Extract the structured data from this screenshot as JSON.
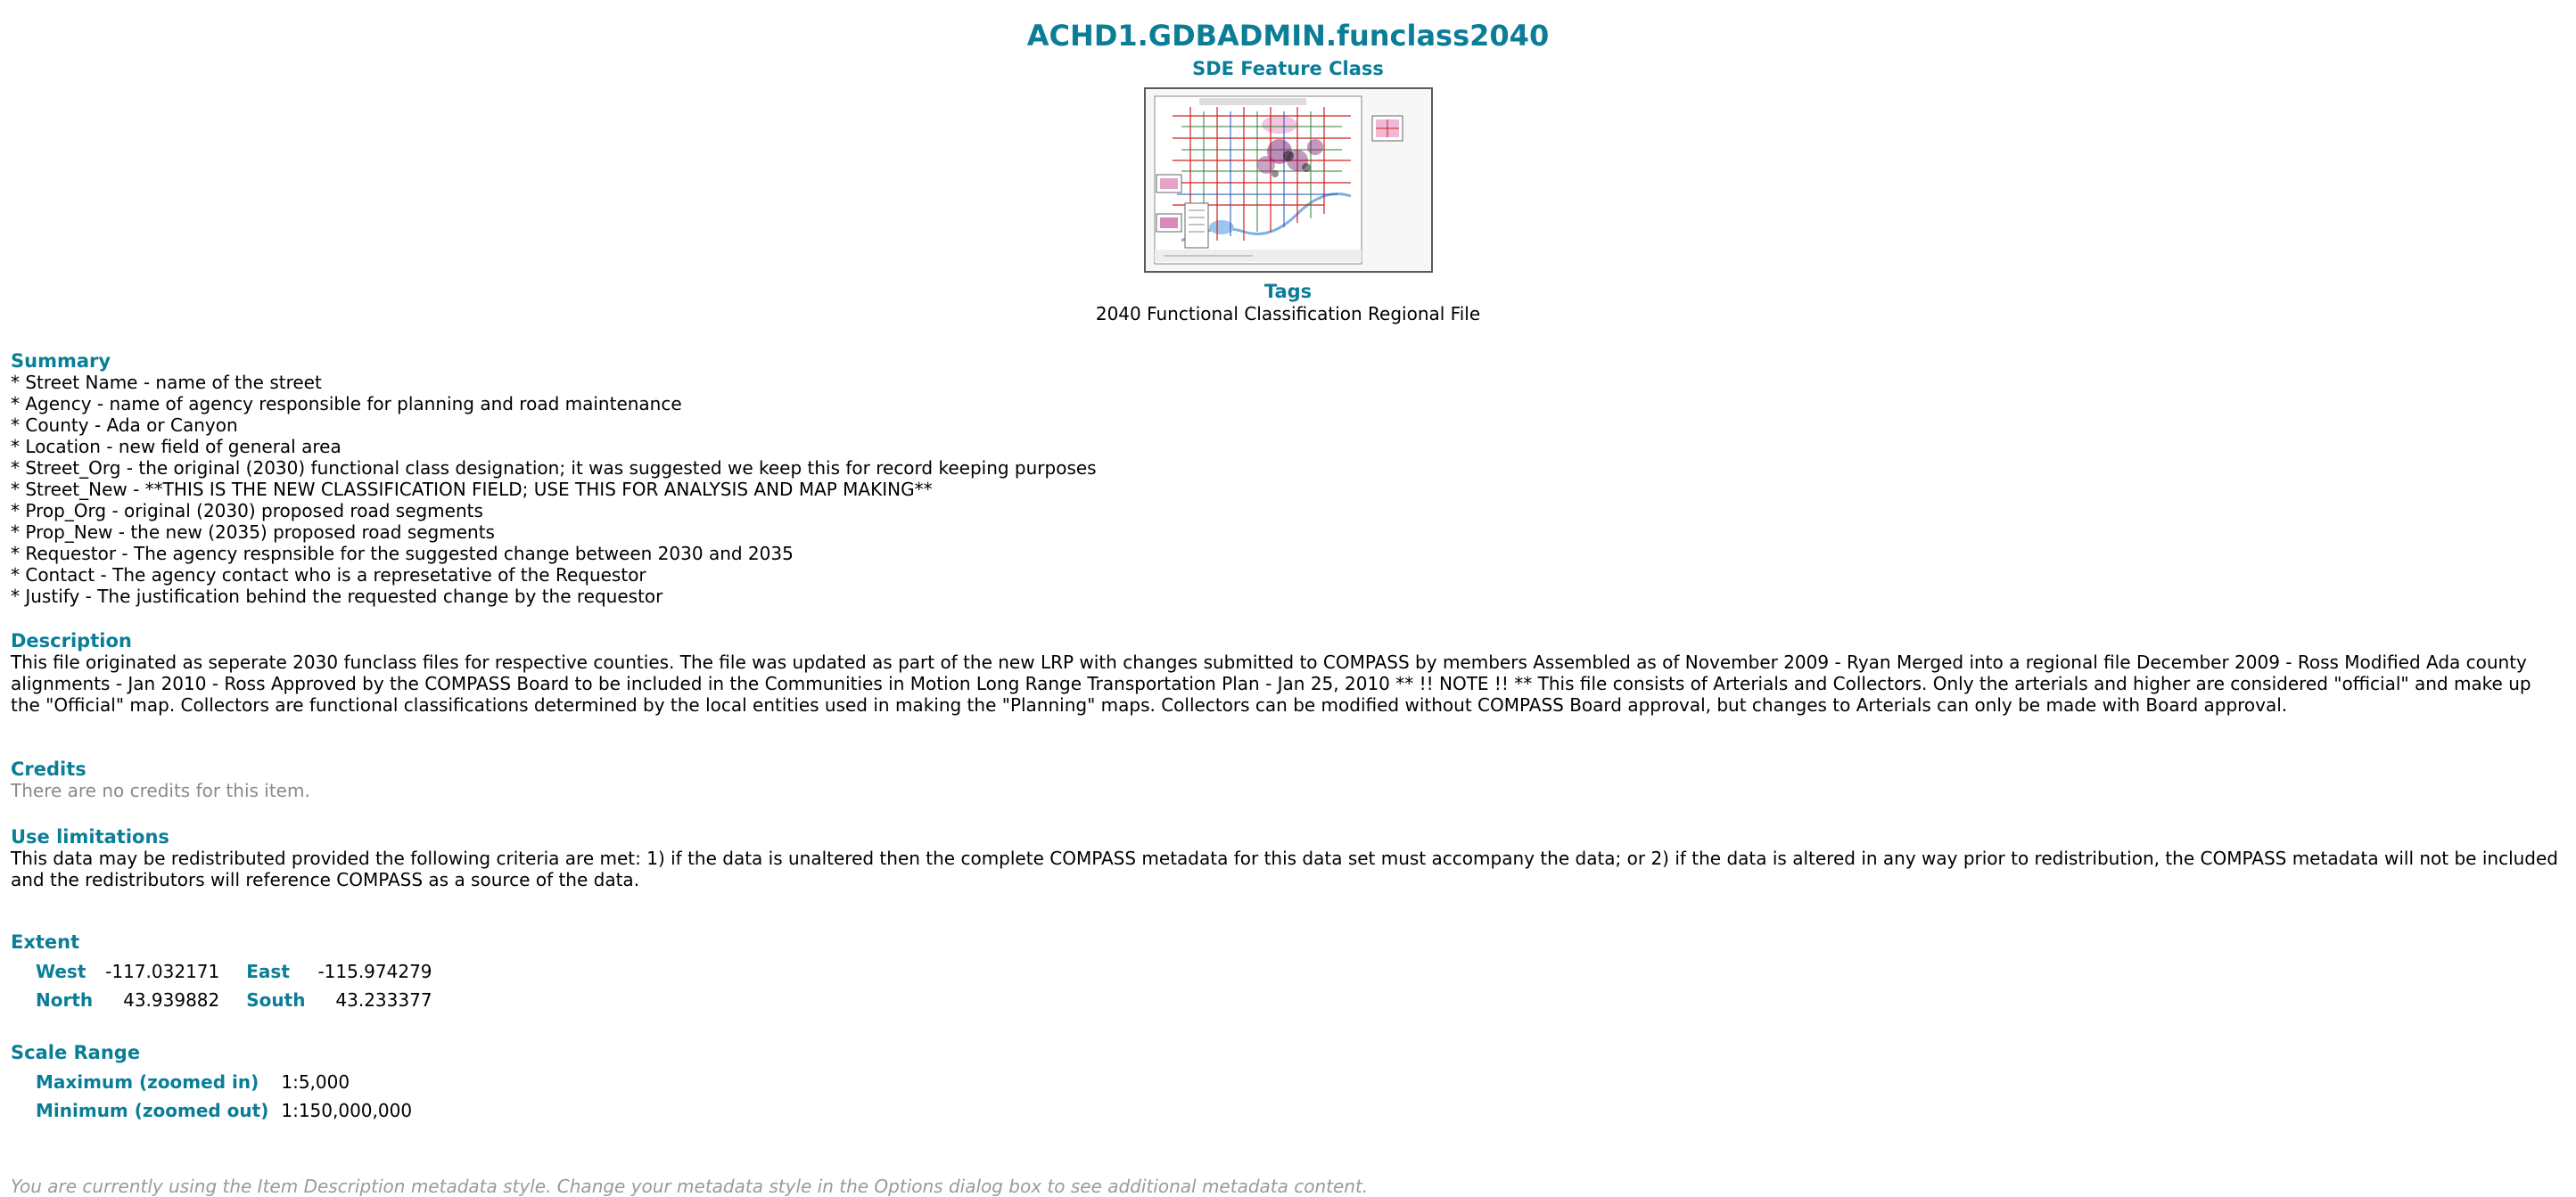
{
  "header": {
    "title": "ACHD1.GDBADMIN.funclass2040",
    "subtitle": "SDE Feature Class",
    "tags_label": "Tags",
    "tags_value": "2040 Functional Classification Regional File"
  },
  "summary": {
    "heading": "Summary",
    "lines": [
      "* Street Name - name of the street",
      "* Agency - name of agency responsible for planning and road maintenance",
      "* County - Ada or Canyon",
      "* Location - new field of general area",
      "* Street_Org - the original (2030) functional class designation; it was suggested we keep this for record keeping purposes",
      "* Street_New - **THIS IS THE NEW CLASSIFICATION FIELD; USE THIS FOR ANALYSIS AND MAP MAKING**",
      "* Prop_Org - original (2030) proposed road segments",
      "* Prop_New - the new (2035) proposed road segments",
      "* Requestor - The agency respnsible for the suggested change between 2030 and 2035",
      "* Contact - The agency contact who is a represetative of the Requestor",
      "* Justify - The justification behind the requested change by the requestor"
    ]
  },
  "description": {
    "heading": "Description",
    "text": "This file originated as seperate 2030 funclass files for respective counties. The file was updated as part of the new LRP with changes submitted to COMPASS by members Assembled as of November 2009 - Ryan Merged into a regional file December 2009 - Ross Modified Ada county alignments - Jan 2010 - Ross Approved by the COMPASS Board to be included in the Communities in Motion Long Range Transportation Plan - Jan 25, 2010 ** !! NOTE !! ** This file consists of Arterials and Collectors. Only the arterials and higher are considered \"official\" and make up the \"Official\" map. Collectors are functional classifications determined by the local entities used in making the \"Planning\" maps. Collectors can be modified without COMPASS Board approval, but changes to Arterials can only be made with Board approval."
  },
  "credits": {
    "heading": "Credits",
    "text": "There are no credits for this item."
  },
  "use_limitations": {
    "heading": "Use limitations",
    "text": "This data may be redistributed provided the following criteria are met: 1) if the data is unaltered then the complete COMPASS metadata for this data set must accompany the data; or 2) if the data is altered in any way prior to redistribution, the COMPASS metadata will not be included and the redistributors will reference COMPASS as a source of the data."
  },
  "extent": {
    "heading": "Extent",
    "west_label": "West",
    "west_value": "-117.032171",
    "east_label": "East",
    "east_value": "-115.974279",
    "north_label": "North",
    "north_value": "43.939882",
    "south_label": "South",
    "south_value": "43.233377"
  },
  "scale_range": {
    "heading": "Scale Range",
    "max_label": "Maximum (zoomed in)",
    "max_value": "1:5,000",
    "min_label": "Minimum (zoomed out)",
    "min_value": "1:150,000,000"
  },
  "footer": {
    "note": "You are currently using the Item Description metadata style. Change your metadata style in the Options dialog box to see additional metadata content."
  },
  "colors": {
    "accent": "#0b7d97",
    "muted": "#8a8a8a"
  }
}
